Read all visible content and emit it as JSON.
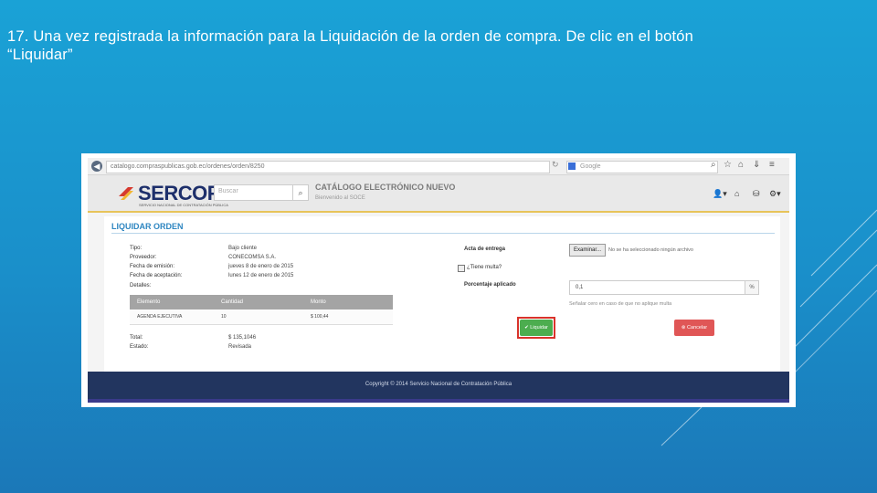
{
  "slide": {
    "instruction_line1": "17. Una vez registrada la información para la Liquidación de la orden de compra. De clic en el botón",
    "instruction_line2": "“Liquidar”"
  },
  "browser": {
    "url": "catalogo.compraspublicas.gob.ec/ordenes/orden/8250",
    "search_placeholder": "Google",
    "icons": [
      "back-icon",
      "reload-icon",
      "search-icon",
      "star-icon",
      "home-icon",
      "download-icon",
      "menu-icon"
    ]
  },
  "header": {
    "logo": "SERCOP",
    "logo_sub": "SERVICIO NACIONAL DE CONTRATACIÓN PÚBLICA",
    "search_placeholder": "Buscar",
    "catalog_title": "CATÁLOGO ELECTRÓNICO NUEVO",
    "catalog_sub": "Bienvenido al SOCE"
  },
  "panel": {
    "title": "LIQUIDAR ORDEN",
    "fields": [
      {
        "label": "Tipo:",
        "value": "Bajo cliente"
      },
      {
        "label": "Proveedor:",
        "value": "CONECOMSA S.A."
      },
      {
        "label": "Fecha de emisión:",
        "value": "jueves 8 de enero de 2015"
      },
      {
        "label": "Fecha de aceptación:",
        "value": "lunes 12 de enero de 2015"
      },
      {
        "label": "Detalles:",
        "value": ""
      }
    ],
    "table": {
      "headers": [
        "Elemento",
        "Cantidad",
        "Monto"
      ],
      "rows": [
        [
          "AGENDA EJECUTIVA",
          "10",
          "$ 100,44"
        ]
      ]
    },
    "total_label": "Total:",
    "total_value": "$ 135,1046",
    "estado_label": "Estado:",
    "estado_value": "Revisada",
    "acta_label": "Acta de entrega",
    "browse_label": "Examinar...",
    "no_file": "No se ha seleccionado ningún archivo",
    "multa_label": "¿Tiene multa?",
    "percent_label": "Porcentaje aplicado",
    "percent_value": "0,1",
    "percent_symbol": "%",
    "percent_hint": "Señalar cero en caso de que no aplique multa",
    "liquidar_label": "✔ Liquidar",
    "cancel_label": "⊗ Cancelar"
  },
  "footer": {
    "copyright": "Copyright © 2014 Servicio Nacional de Contratación Pública"
  },
  "colors": {
    "slide_bg": "#1a8fca",
    "accent_blue": "#2e86c1",
    "liquidar_green": "#4cad4f",
    "cancel_red": "#e05656",
    "highlight_red": "#d9332b",
    "footer_navy": "#22355f"
  }
}
